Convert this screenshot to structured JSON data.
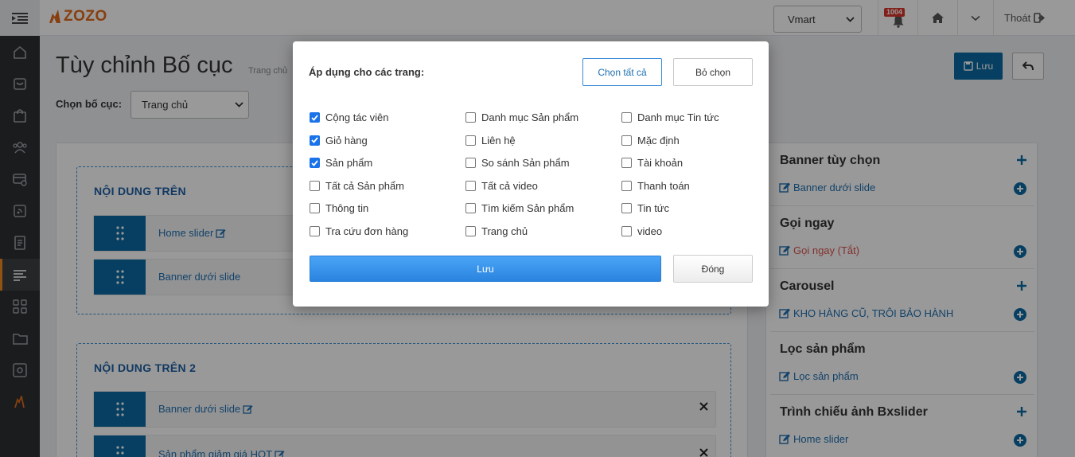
{
  "brand": {
    "logo_text": "ZOZO",
    "accent": "#f18a1e",
    "primary": "#0b6aa2"
  },
  "topbar": {
    "store_select": "Vmart",
    "notification_count": "1004",
    "logout_label": "Thoát"
  },
  "sidebar": {
    "active_index": 7
  },
  "page": {
    "title": "Tùy chỉnh Bố cục",
    "subtitle": "Trang chủ",
    "layout_label": "Chọn bố cục:",
    "layout_value": "Trang chủ",
    "save_label": "Lưu"
  },
  "sections": [
    {
      "title": "NỘI DUNG TRÊN",
      "widgets": [
        {
          "label": "Home slider"
        },
        {
          "label": "Banner dưới slide"
        }
      ]
    },
    {
      "title": "NỘI DUNG TRÊN 2",
      "widgets": [
        {
          "label": "Banner dưới slide"
        },
        {
          "label": "Sản phẩm giảm giá HOT"
        }
      ]
    }
  ],
  "right_panel": [
    {
      "title": "Banner tùy chọn",
      "item": "Banner dưới slide"
    },
    {
      "title": "Gọi ngay",
      "item": "Gọi ngay (Tắt)"
    },
    {
      "title": "Carousel",
      "item": "KHO HÀNG CŨ, TRÔI BẢO HÀNH"
    },
    {
      "title": "Lọc sản phẩm",
      "item": "Lọc sản phẩm"
    },
    {
      "title": "Trình chiếu ảnh Bxslider",
      "item": "Home slider"
    }
  ],
  "modal": {
    "title": "Áp dụng cho các trang:",
    "select_all": "Chọn tất cả",
    "deselect": "Bỏ chọn",
    "save": "Lưu",
    "close": "Đóng",
    "pages": [
      {
        "label": "Cộng tác viên",
        "checked": true
      },
      {
        "label": "Danh mục Sản phẩm",
        "checked": false
      },
      {
        "label": "Danh mục Tin tức",
        "checked": false
      },
      {
        "label": "Giỏ hàng",
        "checked": true
      },
      {
        "label": "Liên hệ",
        "checked": false
      },
      {
        "label": "Mặc định",
        "checked": false
      },
      {
        "label": "Sản phẩm",
        "checked": true
      },
      {
        "label": "So sánh Sản phẩm",
        "checked": false
      },
      {
        "label": "Tài khoản",
        "checked": false
      },
      {
        "label": "Tất cả Sản phẩm",
        "checked": false
      },
      {
        "label": "Tất cả video",
        "checked": false
      },
      {
        "label": "Thanh toán",
        "checked": false
      },
      {
        "label": "Thông tin",
        "checked": false
      },
      {
        "label": "Tìm kiếm Sản phẩm",
        "checked": false
      },
      {
        "label": "Tin tức",
        "checked": false
      },
      {
        "label": "Tra cứu đơn hàng",
        "checked": false
      },
      {
        "label": "Trang chủ",
        "checked": false
      },
      {
        "label": "video",
        "checked": false
      }
    ]
  }
}
